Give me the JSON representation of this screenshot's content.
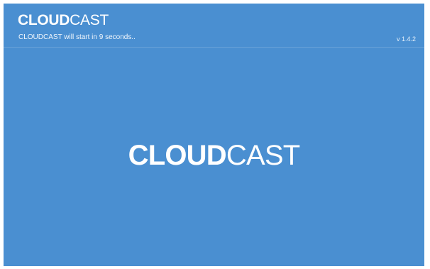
{
  "header": {
    "brand_bold": "CLOUD",
    "brand_light": "CAST",
    "status_text": "CLOUDCAST will start in 9 seconds..",
    "version": "v 1.4.2"
  },
  "splash": {
    "logo_bold": "CLOUD",
    "logo_light": "CAST"
  },
  "colors": {
    "background": "#4a8fd1",
    "text": "#ffffff"
  }
}
